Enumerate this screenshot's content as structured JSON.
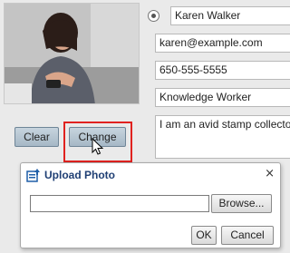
{
  "profile": {
    "photo_alt": "",
    "name": "Karen Walker",
    "email": "karen@example.com",
    "phone": "650-555-5555",
    "role": "Knowledge Worker",
    "bio": "I am an avid stamp collector"
  },
  "photo_actions": {
    "clear_label": "Clear",
    "change_label": "Change"
  },
  "upload_dialog": {
    "title": "Upload Photo",
    "close_glyph": "×",
    "file_path": "",
    "browse_label": "Browse...",
    "ok_label": "OK",
    "cancel_label": "Cancel"
  },
  "colors": {
    "highlight": "#e0221f",
    "dialog_title": "#1f3f74",
    "button_fill": "#b6c6d3"
  },
  "icons": {
    "dialog": "upload-photo-icon",
    "cursor": "mouse-pointer-icon"
  }
}
